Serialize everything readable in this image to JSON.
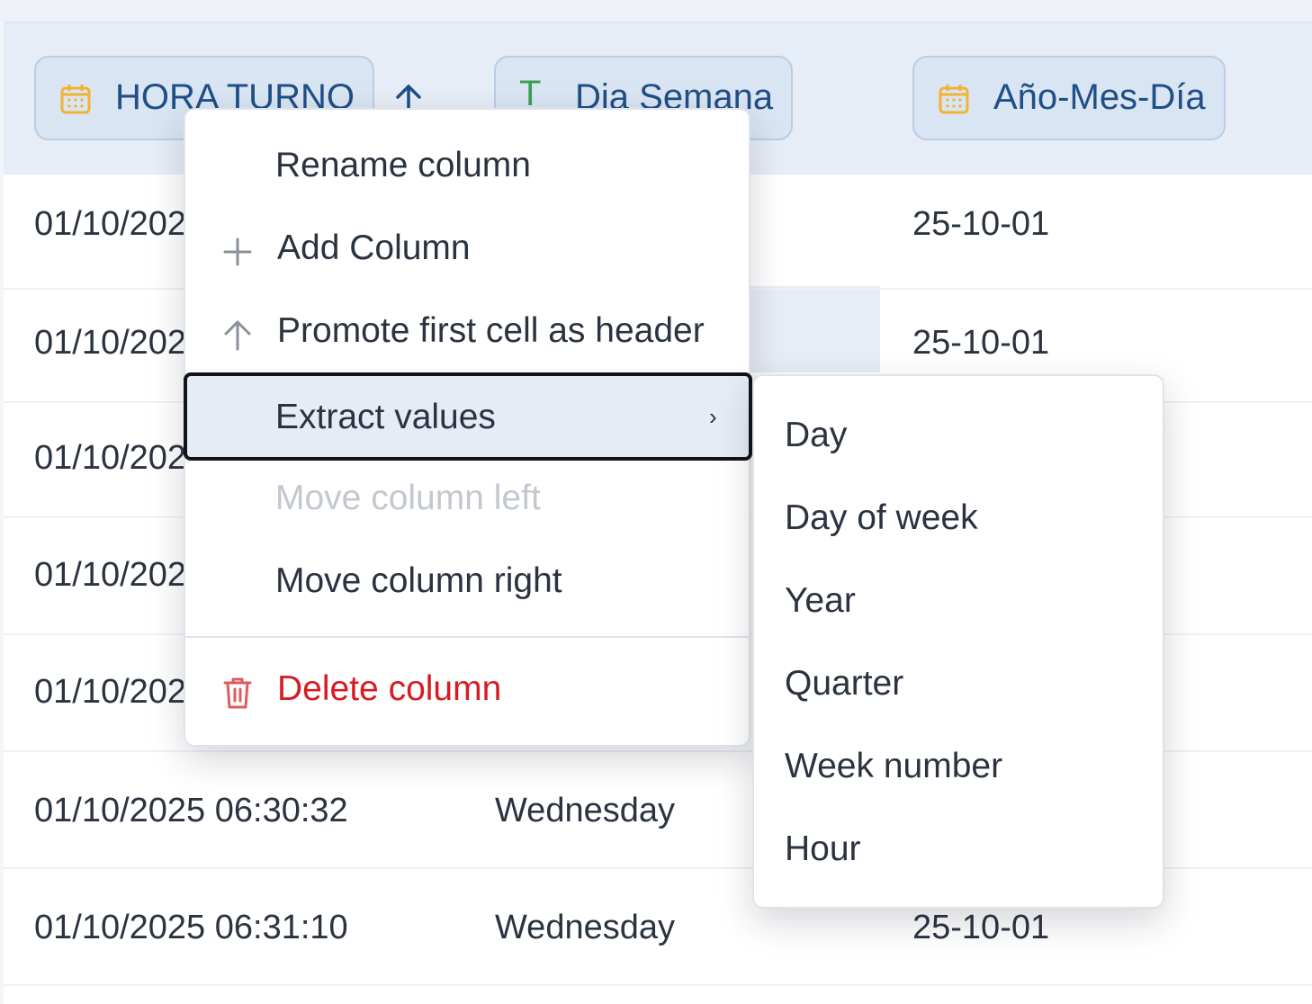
{
  "header": {
    "columns": [
      {
        "label": "HORA TURNO",
        "icon": "calendar-icon",
        "sort": "ascending",
        "sort_icon": "arrow-up-icon"
      },
      {
        "label": "Dia Semana",
        "icon": "text-type-icon",
        "icon_glyph": "T"
      },
      {
        "label": "Año-Mes-Día",
        "icon": "calendar-icon"
      }
    ]
  },
  "rows": [
    {
      "hora": "01/10/202",
      "dia": "",
      "fecha": "25-10-01"
    },
    {
      "hora": "01/10/202",
      "dia": "",
      "fecha": "25-10-01"
    },
    {
      "hora": "01/10/202",
      "dia": "",
      "fecha": ""
    },
    {
      "hora": "01/10/202",
      "dia": "",
      "fecha": ""
    },
    {
      "hora": "01/10/202",
      "dia": "",
      "fecha": ""
    },
    {
      "hora": "01/10/2025 06:30:32",
      "dia": "Wednesday",
      "fecha": ""
    },
    {
      "hora": "01/10/2025 06:31:10",
      "dia": "Wednesday",
      "fecha": "25-10-01"
    }
  ],
  "context_menu": {
    "items": [
      {
        "label": "Rename column",
        "icon": ""
      },
      {
        "label": "Add Column",
        "icon": "plus-icon"
      },
      {
        "label": "Promote first cell as header",
        "icon": "arrow-up-icon"
      },
      {
        "label": "Extract values",
        "icon": "",
        "state": "active",
        "submenu_indicator": "›"
      },
      {
        "label": "Move column left",
        "icon": "",
        "state": "disabled"
      },
      {
        "label": "Move column right",
        "icon": ""
      },
      {
        "label": "Delete column",
        "icon": "trash-icon",
        "state": "danger"
      }
    ]
  },
  "submenu": {
    "items": [
      "Day",
      "Day of week",
      "Year",
      "Quarter",
      "Week number",
      "Hour"
    ]
  },
  "colors": {
    "header_bg": "#e6edf6",
    "pill_bg": "#d9e5f2",
    "pill_text": "#1f4f86",
    "calendar_icon": "#f2b233",
    "text_icon": "#3aa04f",
    "danger": "#d81b22",
    "disabled": "#c3c8cf",
    "active_item_bg": "#e6ecf5"
  }
}
